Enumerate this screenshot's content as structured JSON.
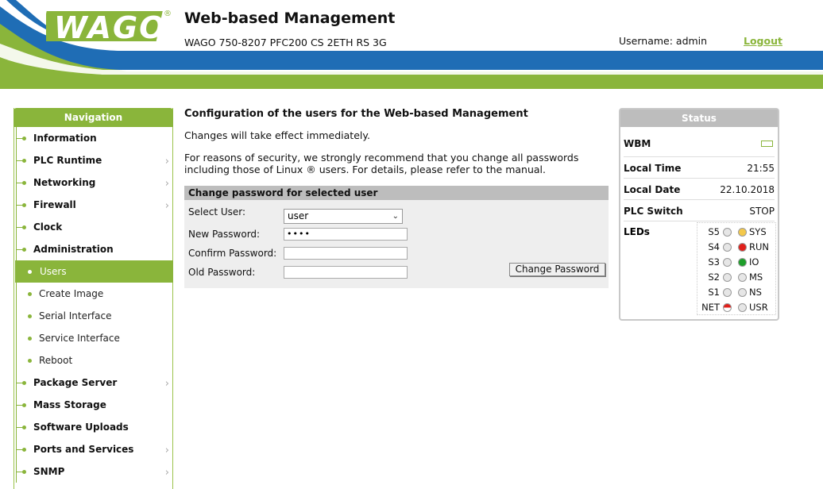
{
  "header": {
    "logo_text": "WAGO",
    "title": "Web-based Management",
    "device": "WAGO 750-8207 PFC200 CS 2ETH RS 3G",
    "username_label": "Username: admin",
    "logout_label": "Logout",
    "colors": {
      "blue": "#1f6db5",
      "green": "#8ab53b"
    }
  },
  "nav": {
    "title": "Navigation",
    "items": [
      {
        "label": "Information",
        "arrow": ""
      },
      {
        "label": "PLC Runtime",
        "arrow": "›"
      },
      {
        "label": "Networking",
        "arrow": "›"
      },
      {
        "label": "Firewall",
        "arrow": "›"
      },
      {
        "label": "Clock",
        "arrow": ""
      },
      {
        "label": "Administration",
        "arrow": ""
      }
    ],
    "sub_items": [
      {
        "label": "Users",
        "active": true
      },
      {
        "label": "Create Image"
      },
      {
        "label": "Serial Interface"
      },
      {
        "label": "Service Interface"
      },
      {
        "label": "Reboot"
      }
    ],
    "items_after": [
      {
        "label": "Package Server",
        "arrow": "›"
      },
      {
        "label": "Mass Storage",
        "arrow": ""
      },
      {
        "label": "Software Uploads",
        "arrow": ""
      },
      {
        "label": "Ports and Services",
        "arrow": "›"
      },
      {
        "label": "SNMP",
        "arrow": "›"
      }
    ]
  },
  "main": {
    "title": "Configuration of the users for the Web-based Management",
    "para1": "Changes will take effect immediately.",
    "para2": "For reasons of security, we strongly recommend that you change all passwords including those of Linux ® users. For details, please refer to the manual.",
    "panel": {
      "title": "Change password for selected user",
      "select_user_label": "Select User:",
      "select_user_value": "user",
      "new_password_label": "New Password:",
      "new_password_value": "••••",
      "confirm_password_label": "Confirm Password:",
      "confirm_password_value": "",
      "old_password_label": "Old Password:",
      "old_password_value": "",
      "button_label": "Change Password"
    }
  },
  "status": {
    "title": "Status",
    "wbm_label": "WBM",
    "local_time_label": "Local Time",
    "local_time_value": "21:55",
    "local_date_label": "Local Date",
    "local_date_value": "22.10.2018",
    "plc_switch_label": "PLC Switch",
    "plc_switch_value": "STOP",
    "leds_label": "LEDs",
    "leds": [
      {
        "left": "S5",
        "right": "SYS",
        "left_color": "#e6e6e6",
        "right_color": "#f3c84b"
      },
      {
        "left": "S4",
        "right": "RUN",
        "left_color": "#e6e6e6",
        "right_color": "#e0201b"
      },
      {
        "left": "S3",
        "right": "IO",
        "left_color": "#e6e6e6",
        "right_color": "#1e9e2a"
      },
      {
        "left": "S2",
        "right": "MS",
        "left_color": "#e6e6e6",
        "right_color": "#e6e6e6"
      },
      {
        "left": "S1",
        "right": "NS",
        "left_color": "#e6e6e6",
        "right_color": "#e6e6e6"
      },
      {
        "left": "NET",
        "right": "USR",
        "left_color": "half-red",
        "right_color": "#e6e6e6"
      }
    ]
  }
}
